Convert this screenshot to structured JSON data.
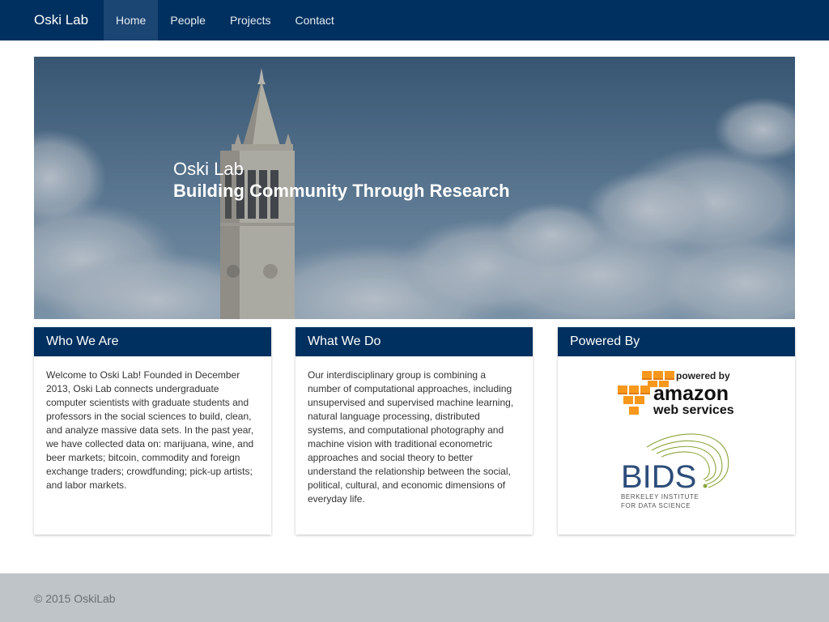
{
  "nav": {
    "brand": "Oski Lab",
    "items": [
      {
        "label": "Home",
        "active": true
      },
      {
        "label": "People",
        "active": false
      },
      {
        "label": "Projects",
        "active": false
      },
      {
        "label": "Contact",
        "active": false
      }
    ]
  },
  "hero": {
    "title": "Oski Lab",
    "subtitle": "Building Community Through Research"
  },
  "panels": [
    {
      "heading": "Who We Are",
      "body": "Welcome to Oski Lab! Founded in December 2013, Oski Lab connects undergraduate computer scientists with graduate students and professors in the social sciences to build, clean, and analyze massive data sets. In the past year, we have collected data on: marijuana, wine, and beer markets; bitcoin, commodity and foreign exchange traders; crowdfunding; pick-up artists; and labor markets."
    },
    {
      "heading": "What We Do",
      "body": "Our interdisciplinary group is combining a number of computational approaches, including unsupervised and supervised machine learning, natural language processing, distributed systems, and computational photography and machine vision with traditional econometric approaches and social theory to better understand the relationship between the social, political, cultural, and economic dimensions of everyday life."
    },
    {
      "heading": "Powered By",
      "logos": {
        "aws": {
          "top": "powered by",
          "main": "amazon",
          "sub": "web services"
        },
        "bids": {
          "main": "BIDS",
          "line1": "BERKELEY INSTITUTE",
          "line2": "FOR DATA SCIENCE"
        }
      }
    }
  ],
  "footer": {
    "text": "© 2015 OskiLab"
  },
  "colors": {
    "navbar": "#00305f",
    "nav_active": "#1b4573",
    "footer": "#bfc4c8",
    "aws_orange": "#f7981d",
    "bids_blue": "#2d4d7a",
    "bids_green": "#8aa63b"
  }
}
